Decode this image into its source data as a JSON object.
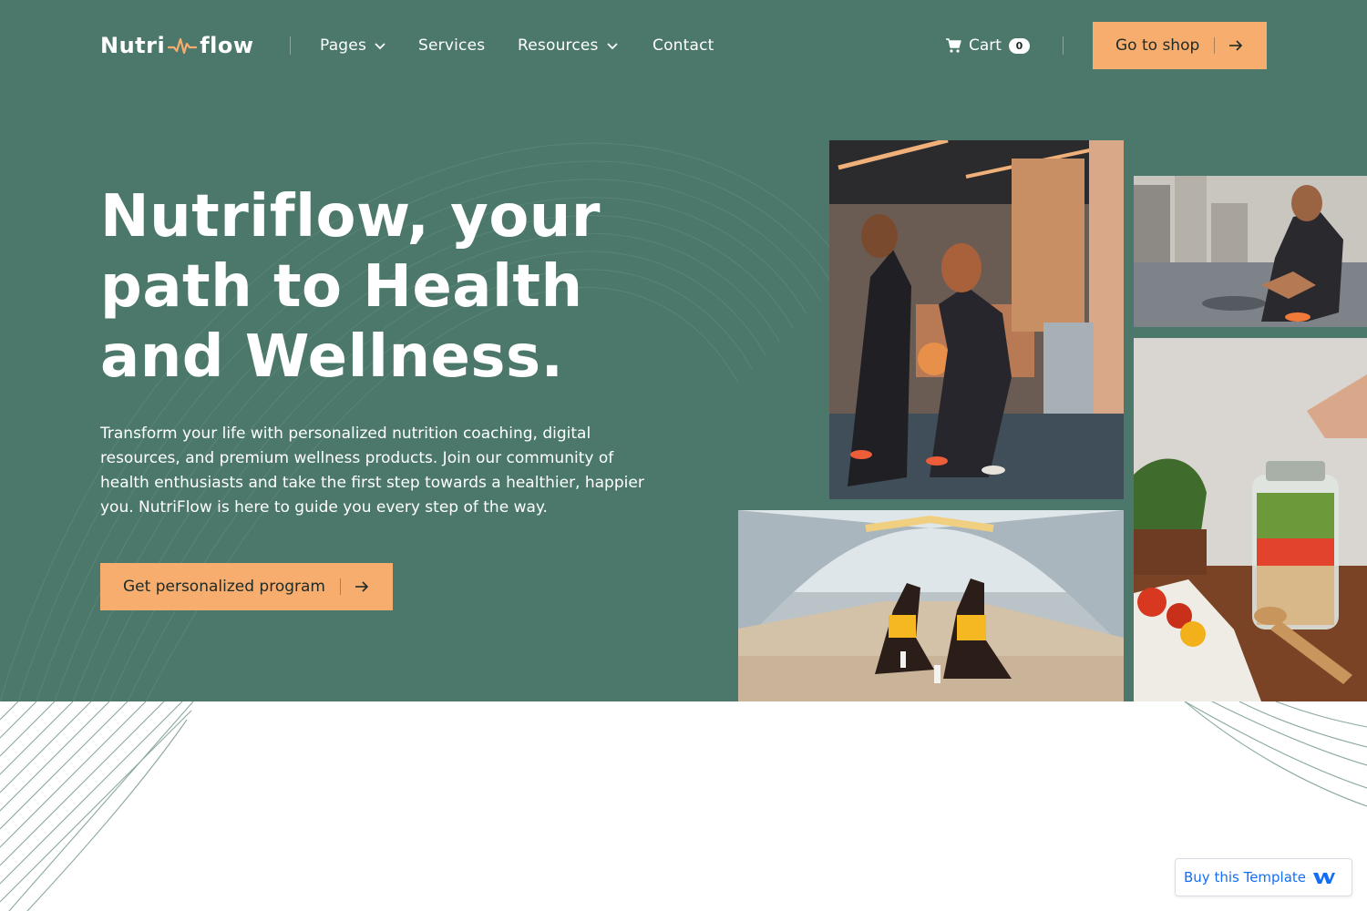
{
  "brand": {
    "logo_left": "Nutri",
    "logo_right": "flow",
    "accent_color": "#f7ad6e",
    "hero_bg_color": "#4b786a",
    "logo_icon": "pulse-icon"
  },
  "nav": {
    "items": [
      {
        "label": "Pages",
        "dropdown": true
      },
      {
        "label": "Services",
        "dropdown": false
      },
      {
        "label": "Resources",
        "dropdown": true
      },
      {
        "label": "Contact",
        "dropdown": false
      }
    ],
    "cart": {
      "label": "Cart",
      "count": "0",
      "icon": "cart-icon"
    },
    "shop_button": {
      "label": "Go to shop",
      "icon": "arrow-right-icon"
    }
  },
  "hero": {
    "headline_lines": [
      "Nutriflow, your",
      "path to Health",
      "and Wellness."
    ],
    "description": "Transform your life with personalized nutrition coaching, digital resources, and premium wellness products. Join our community of health enthusiasts and take the first step towards a healthier, happier you. NutriFlow is here to guide you every step of the way.",
    "cta_label": "Get personalized program",
    "cta_icon": "arrow-right-icon"
  },
  "badge": {
    "label": "Buy this Template",
    "icon": "webflow-logo-icon"
  }
}
